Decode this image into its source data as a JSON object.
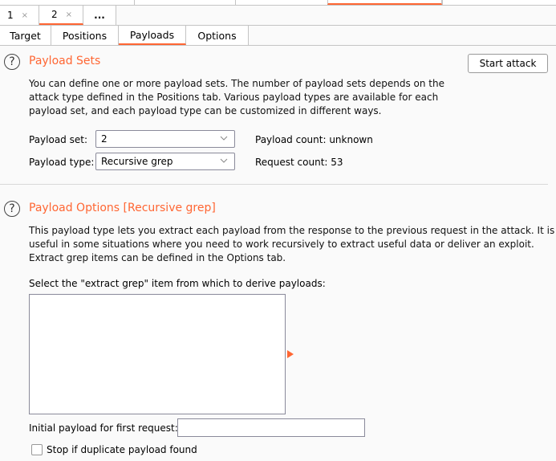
{
  "attack_tabs": [
    {
      "label": "1",
      "close": "×",
      "active": false
    },
    {
      "label": "2",
      "close": "×",
      "active": true
    },
    {
      "label": "...",
      "active": false
    }
  ],
  "sub_tabs": [
    {
      "label": "Target",
      "active": false
    },
    {
      "label": "Positions",
      "active": false
    },
    {
      "label": "Payloads",
      "active": true
    },
    {
      "label": "Options",
      "active": false
    }
  ],
  "accent_color": "#ff6633",
  "payload_sets": {
    "title": "Payload Sets",
    "help_icon": "?",
    "description_lines": [
      "You can define one or more payload sets. The number of payload sets depends on the",
      "attack type defined in the Positions tab. Various payload types are available for each",
      "payload set, and each payload type can be customized in different ways."
    ],
    "start_attack_label": "Start attack",
    "payload_set_label": "Payload set:",
    "payload_set_value": "2",
    "payload_type_label": "Payload type:",
    "payload_type_value": "Recursive grep",
    "payload_count": "Payload count: unknown",
    "request_count": "Request count: 53"
  },
  "payload_options": {
    "title": "Payload Options [Recursive grep]",
    "help_icon": "?",
    "description_lines": [
      "This payload type lets you extract each payload from the response to the previous request in the attack. It is",
      "useful in some situations where you need to work recursively to extract useful data or deliver an exploit.",
      "Extract grep items can be defined in the Options tab."
    ],
    "select_label": "Select the \"extract grep\" item from which to derive payloads:",
    "extract_grep_items": [],
    "initial_payload_label": "Initial payload for first request:",
    "initial_payload_value": "",
    "stop_duplicate_label": "Stop if duplicate payload found",
    "stop_duplicate_checked": false
  }
}
